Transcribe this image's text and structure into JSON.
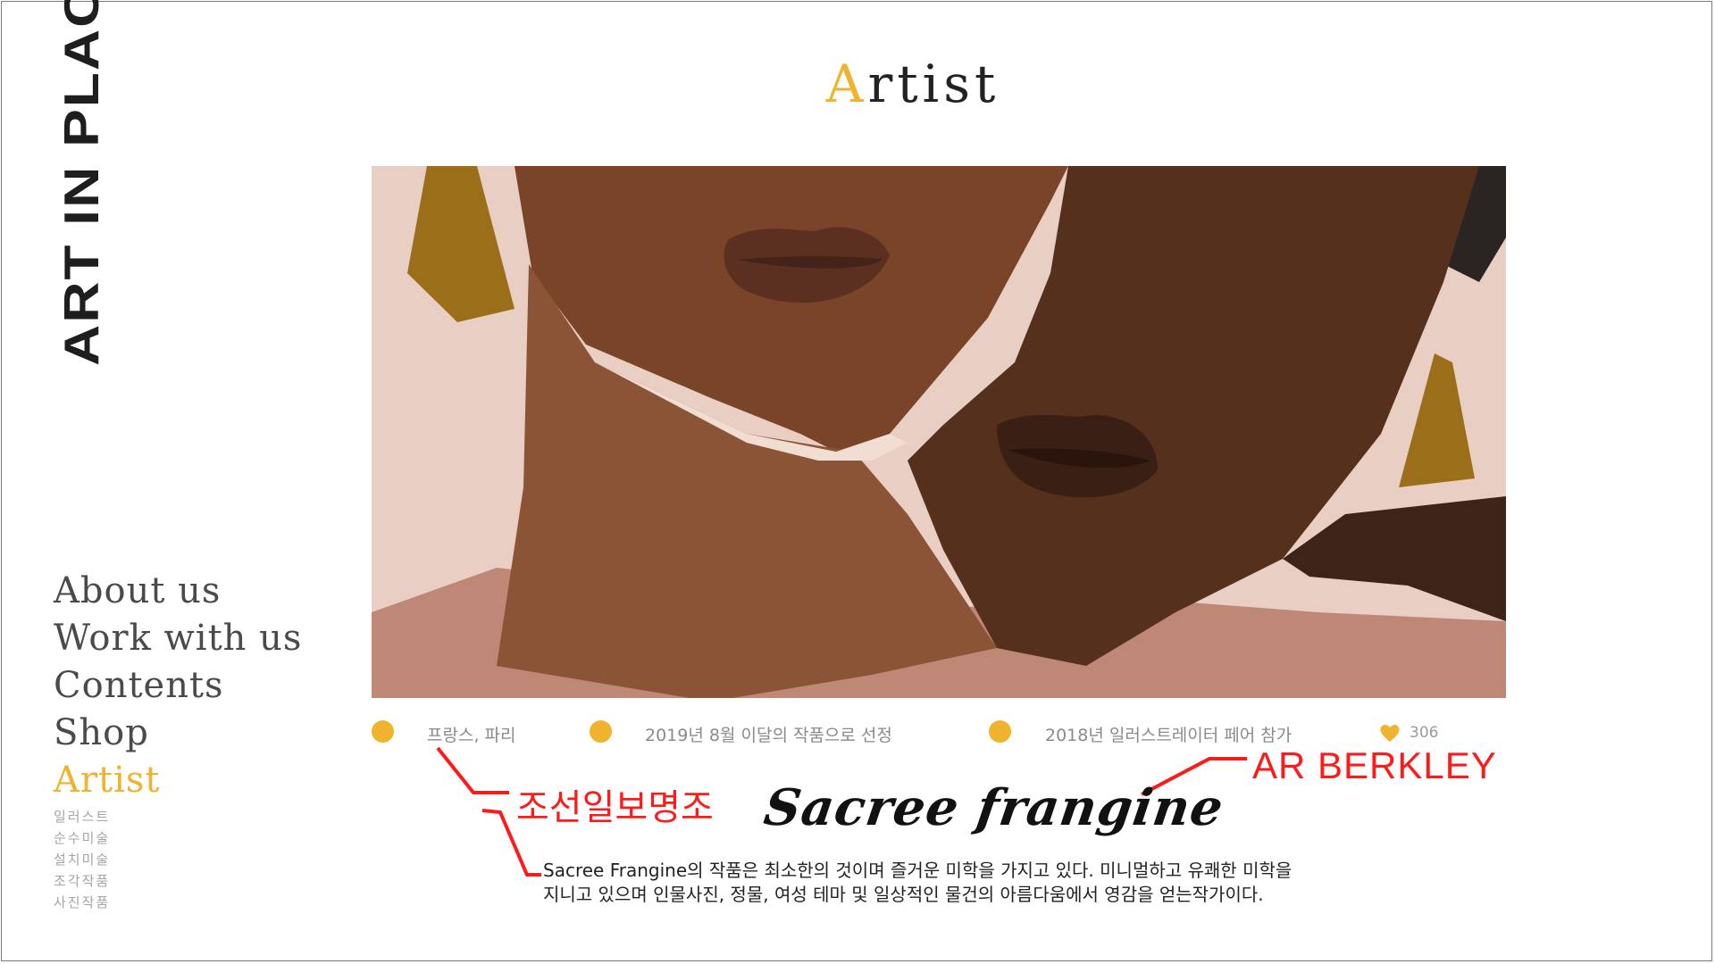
{
  "brand": {
    "vertical_logo": "ART IN PLACE"
  },
  "header": {
    "title_initial": "A",
    "title_rest": "rtist"
  },
  "nav": {
    "items": [
      {
        "label": "About us"
      },
      {
        "label": "Work with us"
      },
      {
        "label": "Contents"
      },
      {
        "label": "Shop"
      },
      {
        "label": "Artist"
      }
    ],
    "sub_items": [
      {
        "label": "일러스트"
      },
      {
        "label": "순수미술"
      },
      {
        "label": "설치미술"
      },
      {
        "label": "조각작품"
      },
      {
        "label": "사진작품"
      }
    ]
  },
  "artwork": {
    "icon": "artwork-image"
  },
  "meta": {
    "items": [
      {
        "text": "프랑스, 파리"
      },
      {
        "text": "2019년 8월 이달의 작품으로 선정"
      },
      {
        "text": "2018년 일러스트레이터 페어 참가"
      }
    ],
    "like_icon": "heart-icon",
    "like_count": "306"
  },
  "artist": {
    "name": "Sacree frangine",
    "description_line1": "Sacree Frangine의 작품은 최소한의 것이며 즐거운 미학을 가지고 있다. 미니멀하고 유쾌한 미학을",
    "description_line2": "지니고 있으며 인물사진, 정물, 여성 테마 및 일상적인 물건의 아름다움에서 영감을 얻는작가이다."
  },
  "annotations": {
    "korean_font": "조선일보명조",
    "english_font": "AR BERKLEY"
  },
  "colors": {
    "accent": "#f0b32e",
    "annotation": "#ff1a1a",
    "text": "#4a4a4a"
  }
}
